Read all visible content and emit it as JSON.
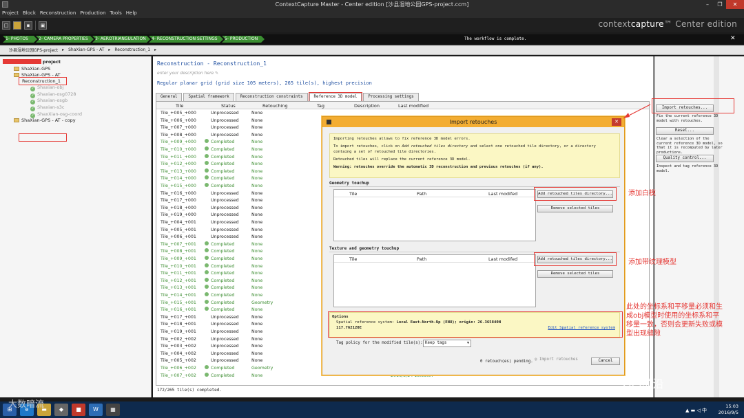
{
  "window": {
    "title": "ContextCapture Master - Center edition [沙县湿地公园GPS-project.ccm]"
  },
  "menu": [
    "Project",
    "Block",
    "Reconstruction",
    "Production",
    "Tools",
    "Help"
  ],
  "brand": {
    "prefix": "context",
    "bold": "capture",
    "suffix": "™ Center edition"
  },
  "workflow": {
    "steps": [
      "1- PHOTOS",
      "2- CAMERA PROPERTIES",
      "3- AEROTRIANGULATION",
      "4- RECONSTRUCTION SETTINGS",
      "5- PRODUCTION"
    ],
    "status": "The workflow is complete.",
    "close": "✕"
  },
  "breadcrumb": [
    "沙县湿地公园GPS-project",
    "▸",
    "ShaXian-GPS - AT",
    "▸",
    "Reconstruction_1",
    "▸"
  ],
  "tree": {
    "project": "project",
    "items": [
      {
        "label": "ShaXian-GPS",
        "kind": "folder"
      },
      {
        "label": "ShaXian-GPS - AT",
        "kind": "folder"
      },
      {
        "label": "Reconstruction_1",
        "kind": "recon"
      },
      {
        "label": "Shaxian-obj",
        "kind": "prod"
      },
      {
        "label": "Shaxian-osg0728",
        "kind": "prod"
      },
      {
        "label": "Shaxian-osgb",
        "kind": "prod"
      },
      {
        "label": "Shaxian-s3c",
        "kind": "prod"
      },
      {
        "label": "ShaxXian-osg-coord",
        "kind": "prod"
      },
      {
        "label": "ShaXian-GPS - AT - copy",
        "kind": "folder"
      }
    ]
  },
  "main": {
    "title": "Reconstruction - Reconstruction_1",
    "description_placeholder": "enter your description here ✎",
    "summary": "Regular planar grid (grid size 105 meters), 265 tile(s), highest precision",
    "tabs": [
      "General",
      "Spatial framework",
      "Reconstruction constraints",
      "Reference 3D model",
      "Processing settings"
    ],
    "columns": [
      "Tile",
      "Status",
      "Retouching",
      "Tag",
      "Description",
      "Last modified"
    ],
    "rows": [
      [
        "Tile_+005_+000",
        "Unprocessed",
        "None",
        "",
        ""
      ],
      [
        "Tile_+006_+000",
        "Unprocessed",
        "None",
        "",
        ""
      ],
      [
        "Tile_+007_+000",
        "Unprocessed",
        "None",
        "",
        ""
      ],
      [
        "Tile_+008_+000",
        "Unprocessed",
        "None",
        "",
        ""
      ],
      [
        "Tile_+009_+000",
        "Completed",
        "None",
        "",
        ""
      ],
      [
        "Tile_+010_+000",
        "Completed",
        "None",
        "",
        ""
      ],
      [
        "Tile_+011_+000",
        "Completed",
        "None",
        "",
        ""
      ],
      [
        "Tile_+012_+000",
        "Completed",
        "None",
        "",
        ""
      ],
      [
        "Tile_+013_+000",
        "Completed",
        "None",
        "",
        ""
      ],
      [
        "Tile_+014_+000",
        "Completed",
        "None",
        "",
        ""
      ],
      [
        "Tile_+015_+000",
        "Completed",
        "None",
        "",
        ""
      ],
      [
        "Tile_+016_+000",
        "Unprocessed",
        "None",
        "",
        ""
      ],
      [
        "Tile_+017_+000",
        "Unprocessed",
        "None",
        "",
        ""
      ],
      [
        "Tile_+018_+000",
        "Unprocessed",
        "None",
        "",
        ""
      ],
      [
        "Tile_+019_+000",
        "Unprocessed",
        "None",
        "",
        ""
      ],
      [
        "Tile_+004_+001",
        "Unprocessed",
        "None",
        "",
        ""
      ],
      [
        "Tile_+005_+001",
        "Unprocessed",
        "None",
        "",
        ""
      ],
      [
        "Tile_+006_+001",
        "Unprocessed",
        "None",
        "",
        ""
      ],
      [
        "Tile_+007_+001",
        "Completed",
        "None",
        "",
        ""
      ],
      [
        "Tile_+008_+001",
        "Completed",
        "None",
        "",
        ""
      ],
      [
        "Tile_+009_+001",
        "Completed",
        "None",
        "",
        ""
      ],
      [
        "Tile_+010_+001",
        "Completed",
        "None",
        "",
        ""
      ],
      [
        "Tile_+011_+001",
        "Completed",
        "None",
        "",
        ""
      ],
      [
        "Tile_+012_+001",
        "Completed",
        "None",
        "",
        ""
      ],
      [
        "Tile_+013_+001",
        "Completed",
        "None",
        "",
        ""
      ],
      [
        "Tile_+014_+001",
        "Completed",
        "None",
        "",
        ""
      ],
      [
        "Tile_+015_+001",
        "Completed",
        "Geometry",
        "",
        ""
      ],
      [
        "Tile_+016_+001",
        "Completed",
        "None",
        "",
        ""
      ],
      [
        "Tile_+017_+001",
        "Unprocessed",
        "None",
        "",
        ""
      ],
      [
        "Tile_+018_+001",
        "Unprocessed",
        "None",
        "",
        ""
      ],
      [
        "Tile_+019_+001",
        "Unprocessed",
        "None",
        "",
        ""
      ],
      [
        "Tile_+002_+002",
        "Unprocessed",
        "None",
        "",
        ""
      ],
      [
        "Tile_+003_+002",
        "Unprocessed",
        "None",
        "",
        ""
      ],
      [
        "Tile_+004_+002",
        "Unprocessed",
        "None",
        "",
        ""
      ],
      [
        "Tile_+005_+002",
        "Unprocessed",
        "None",
        "",
        ""
      ],
      [
        "Tile_+006_+002",
        "Completed",
        "Geometry",
        "",
        "2016/5/24 18:58:37"
      ],
      [
        "Tile_+007_+002",
        "Completed",
        "None",
        "",
        "2016/5/24 18:58:37"
      ]
    ],
    "status": "172/265 tile(s) completed."
  },
  "right_panel": {
    "import_btn": "Import retouches...",
    "import_desc": "Fix the current reference 3D model with retouches.",
    "reset_btn": "Reset...",
    "reset_desc": "Clear a selection of the current reference 3D model, so that it is recomputed by later productions.",
    "qc_btn": "Quality control...",
    "qc_desc": "Inspect and tag reference 3D model."
  },
  "dialog": {
    "title": "Import retouches",
    "close": "✕",
    "info1": "Importing retouches allows to fix reference 3D model errors.",
    "info2a": "To import retouches, click on ",
    "info2b": "Add retouched tiles directory",
    "info2c": " and select one retouched tile directory, or a directory containg a set of retouched tile directories.",
    "info3": "Retouched tiles will replace the current reference 3D model.",
    "info4": "Warning: retouches override the automatic 3D reconstruction and previous retouches (if any).",
    "geom_title": "Geometry touchup",
    "tex_title": "Texture and geometry touchup",
    "table_cols": [
      "Tile",
      "Path",
      "Last modifed"
    ],
    "add_btn": "Add retouched tiles directory...",
    "remove_btn": "Remove selected tiles",
    "options_title": "Options",
    "srs_label": "Spatial reference system: ",
    "srs_value": "Local East-North-Up (ENU); origin: 26.365840N",
    "srs_value2": "117.762120E",
    "edit_srs": "Edit Spatial reference system",
    "tag_label": "Tag policy for the modified tile(s):",
    "tag_value": "Keep tags",
    "pending": "0 retouch(es) pending.",
    "import_btn": "Import retouches",
    "cancel_btn": "Cancel"
  },
  "annotations": {
    "white_model": "添加白模",
    "textured_model": "添加带纹理模型",
    "coord_note": "此处的坐标系和平移量必须和生成obj模型时使用的坐标系和平移量一致，否则会更新失败或模型出现缝隙"
  },
  "watermarks": {
    "left": "大数暗流",
    "right": "GIS前沿"
  },
  "clock": {
    "time": "15:03",
    "date": "2016/9/5"
  },
  "colors": {
    "completed": "#3e8e33",
    "workflow": "#3a8e31",
    "annotation": "#e53935",
    "dialog_title": "#f3ad32"
  }
}
